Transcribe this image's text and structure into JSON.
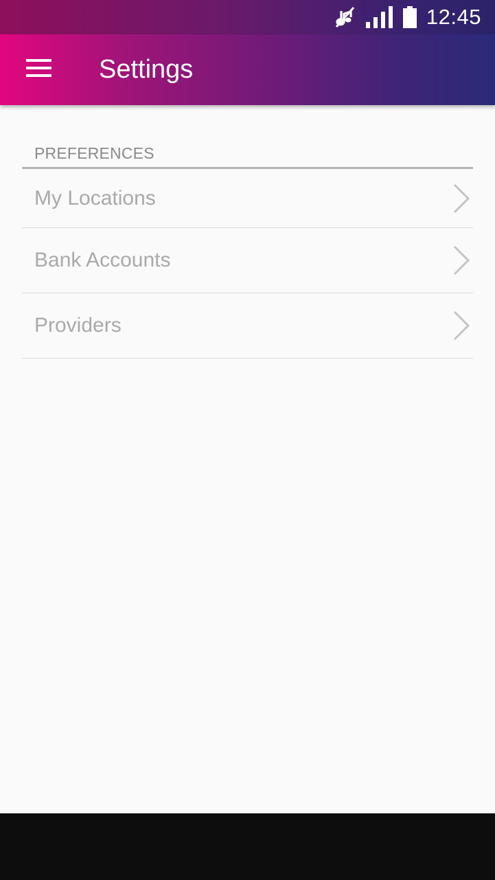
{
  "status_bar": {
    "time": "12:45",
    "icons": [
      "mute-icon",
      "signal-icon",
      "battery-icon"
    ]
  },
  "app_bar": {
    "title": "Settings",
    "menu_icon": "hamburger-menu-icon",
    "gradient_start": "#e2067e",
    "gradient_end": "#2b2a78"
  },
  "preferences": {
    "header": "PREFERENCES",
    "items": [
      {
        "label": "My Locations"
      },
      {
        "label": "Bank Accounts"
      },
      {
        "label": "Providers"
      }
    ]
  }
}
